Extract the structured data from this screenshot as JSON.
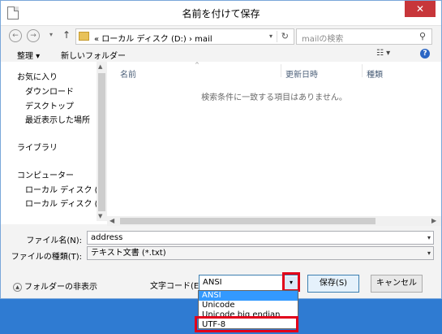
{
  "window": {
    "title": "名前を付けて保存",
    "close_glyph": "✕"
  },
  "nav": {
    "back_glyph": "←",
    "forward_glyph": "→",
    "up_glyph": "↑",
    "breadcrumb": "«  ローカル ディスク (D:)  ›  mail",
    "search_placeholder": "mailの検索"
  },
  "toolbar": {
    "organize": "整理 ▾",
    "new_folder": "新しいフォルダー",
    "view_glyph": "☷ ▾",
    "help_glyph": "?"
  },
  "sidebar": {
    "items": [
      {
        "label": "お気に入り",
        "icon": "star-icon"
      },
      {
        "label": "ダウンロード",
        "icon": "download-folder-icon"
      },
      {
        "label": "デスクトップ",
        "icon": "desktop-icon"
      },
      {
        "label": "最近表示した場所",
        "icon": "recent-places-icon"
      },
      {
        "label": "ライブラリ",
        "icon": "library-icon"
      },
      {
        "label": "コンピューター",
        "icon": "computer-icon"
      },
      {
        "label": "ローカル ディスク (C",
        "icon": "drive-icon"
      },
      {
        "label": "ローカル ディスク (D",
        "icon": "drive-icon"
      }
    ]
  },
  "filelist": {
    "columns": [
      "名前",
      "更新日時",
      "種類"
    ],
    "empty_message": "検索条件に一致する項目はありません。"
  },
  "form": {
    "filename_label": "ファイル名(N):",
    "filename_value": "address",
    "filetype_label": "ファイルの種類(T):",
    "filetype_value": "テキスト文書 (*.txt)"
  },
  "footer": {
    "hide_folders": "フォルダーの非表示",
    "encoding_label": "文字コード(E):",
    "encoding_value": "ANSI",
    "save_button": "保存(S)",
    "cancel_button": "キャンセル"
  },
  "encoding_options": [
    "ANSI",
    "Unicode",
    "Unicode big endian",
    "UTF-8"
  ],
  "colors": {
    "highlight": "#e1001a",
    "selection": "#3399ff",
    "taskbar": "#2f7bd2"
  }
}
